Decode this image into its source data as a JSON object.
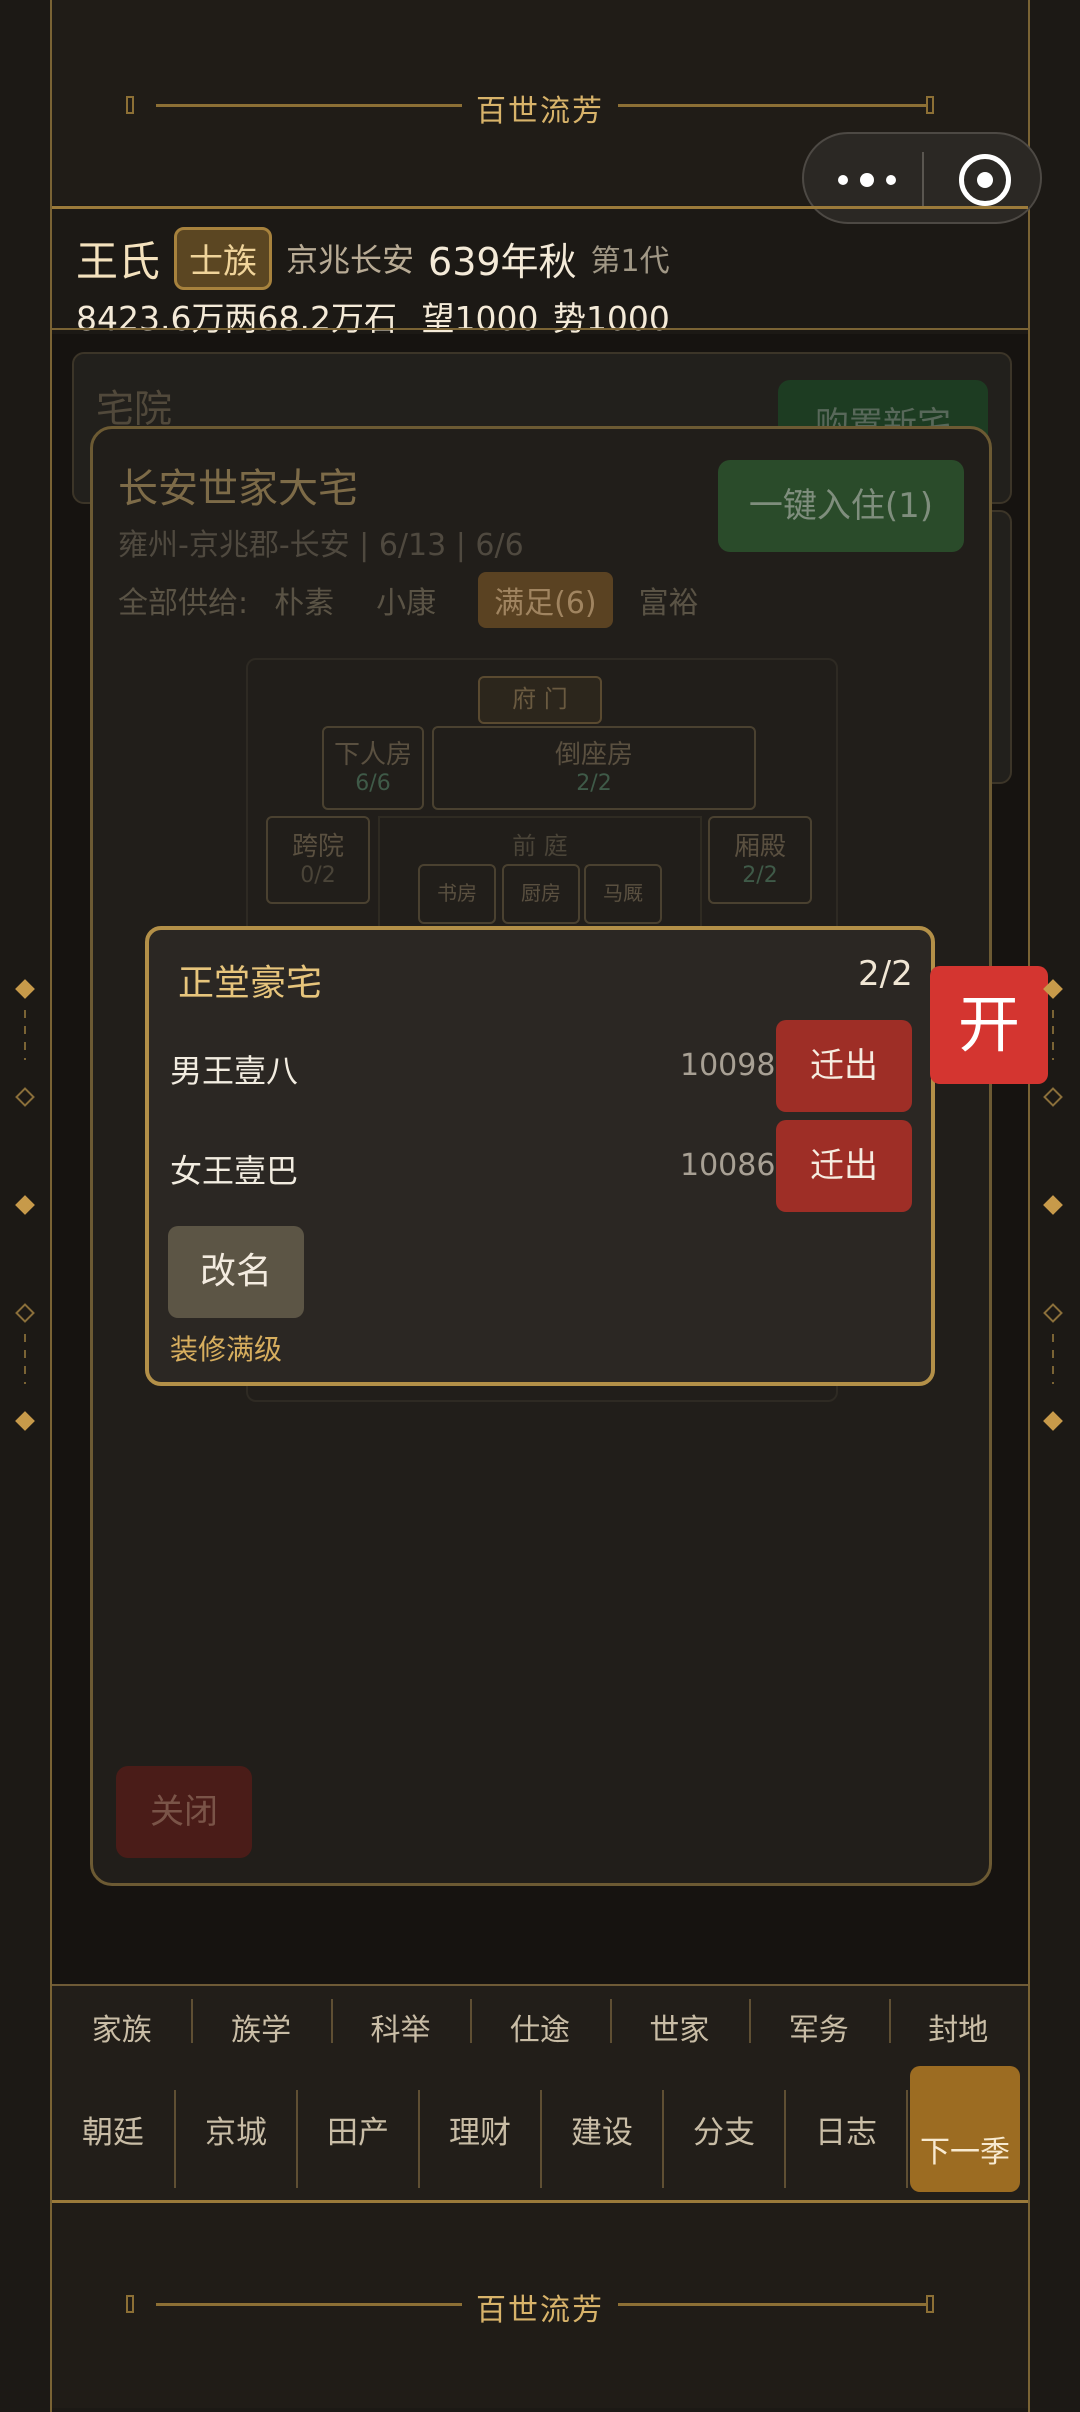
{
  "banner": {
    "title": "百世流芳"
  },
  "header": {
    "clan_name": "王氏",
    "rank": "士族",
    "location": "京兆长安",
    "year": "639年秋",
    "generation": "第1代",
    "money": "8423.6万两",
    "grain": "68.2万石",
    "prestige": "望1000",
    "power": "势1000"
  },
  "background": {
    "section_title": "宅院",
    "buy_button": "购置新宅"
  },
  "residence_modal": {
    "title": "长安世家大宅",
    "subtitle": "雍州-京兆郡-长安 | 6/13 | 6/6",
    "move_in_button": "一键入住(1)",
    "supply_label": "全部供给:",
    "supply_options": [
      "朴素",
      "小康",
      "满足(6)",
      "富裕"
    ],
    "close_button": "关闭",
    "floorplan": {
      "gate": "府 门",
      "servant_room": {
        "name": "下人房",
        "count": "6/6"
      },
      "reverse_room": {
        "name": "倒座房",
        "count": "2/2"
      },
      "side_court": {
        "name": "跨院",
        "count": "0/2"
      },
      "wing_hall": {
        "name": "厢殿",
        "count": "2/2"
      },
      "front_court": "前 庭",
      "small_rooms": [
        "书房",
        "厨房",
        "马厩"
      ]
    }
  },
  "room_popup": {
    "title": "正堂豪宅",
    "capacity": "2/2",
    "occupants": [
      {
        "name": "男王壹八",
        "value": "10098",
        "action": "迁出"
      },
      {
        "name": "女王壹巴",
        "value": "10086",
        "action": "迁出"
      }
    ],
    "rename_button": "改名",
    "decor_status": "装修满级"
  },
  "open_button": "开",
  "nav_row1": [
    "家族",
    "族学",
    "科举",
    "仕途",
    "世家",
    "军务",
    "封地"
  ],
  "nav_row2": [
    "朝廷",
    "京城",
    "田产",
    "理财",
    "建设",
    "分支",
    "日志"
  ],
  "next_season_button": "下一季"
}
